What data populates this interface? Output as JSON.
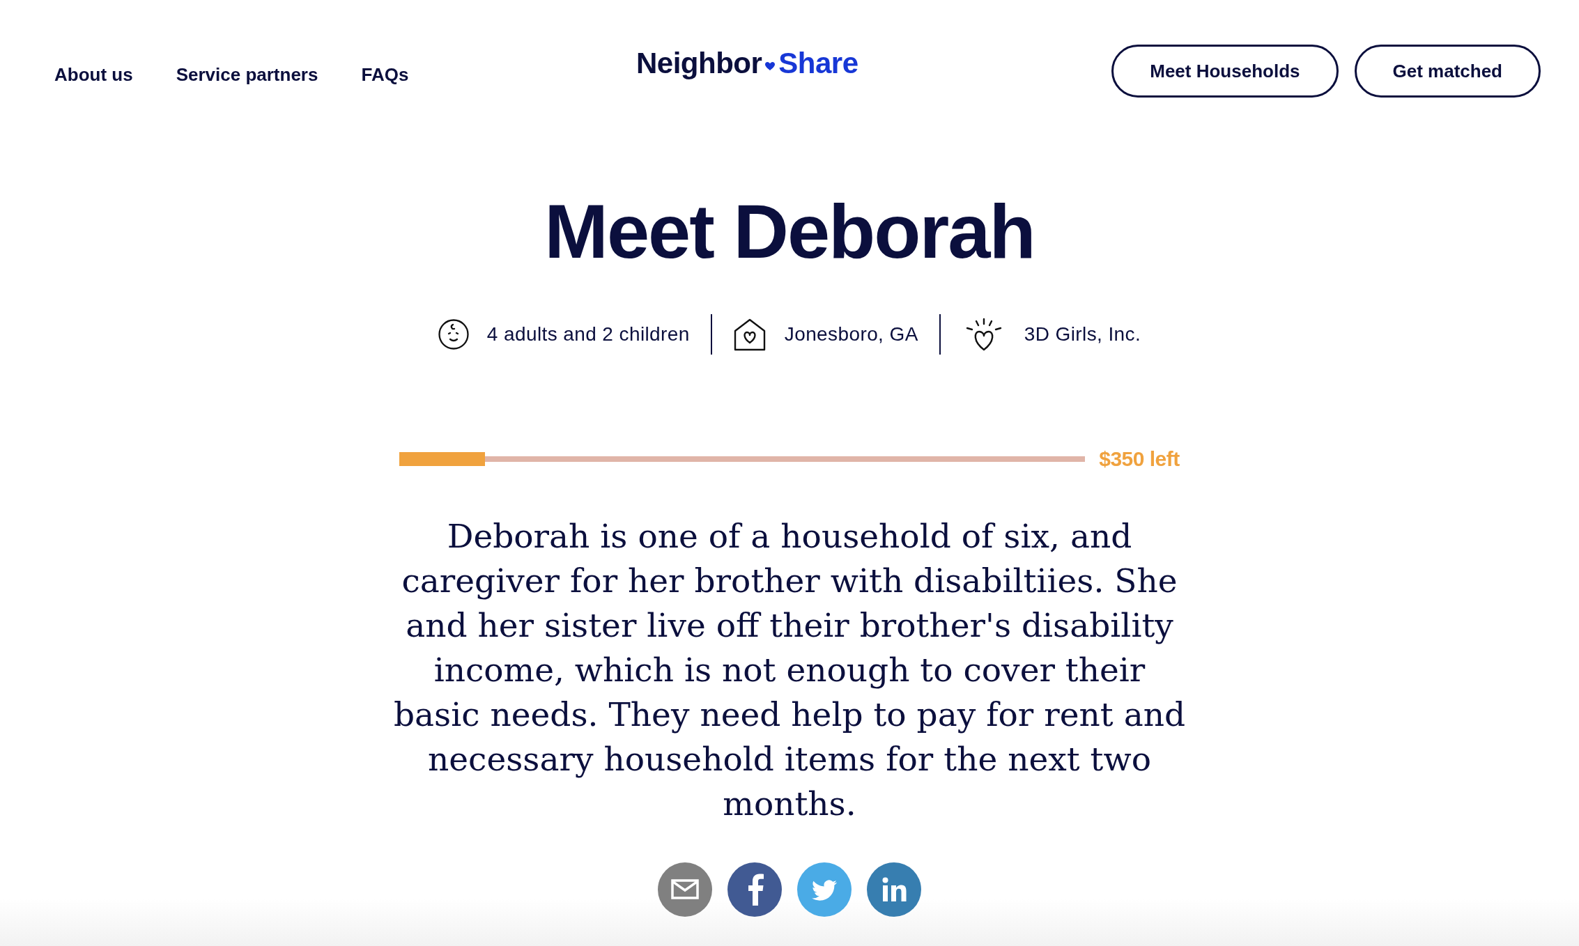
{
  "nav": {
    "links": [
      "About us",
      "Service partners",
      "FAQs"
    ],
    "logo": [
      "Neighbor",
      "Share"
    ],
    "buttons": [
      "Meet Households",
      "Get matched"
    ]
  },
  "profile": {
    "title": "Meet Deborah",
    "facts": [
      {
        "kind": "household",
        "text": "4 adults and 2 children"
      },
      {
        "kind": "location",
        "text": "Jonesboro, GA"
      },
      {
        "kind": "partner",
        "text": "3D Girls, Inc."
      }
    ],
    "progress": {
      "level": 0.125,
      "remaining": "$350 left"
    },
    "story": "Deborah is one of a household of six, and caregiver for her brother with disabiltiies. She and her sister live off their brother's disability income, which is not enough to cover their basic needs. They need help to pay for rent and necessary household items for the next two months.",
    "share": [
      {
        "kind": "email"
      },
      {
        "kind": "facebook"
      },
      {
        "kind": "twitter"
      },
      {
        "kind": "linkedin"
      }
    ]
  }
}
